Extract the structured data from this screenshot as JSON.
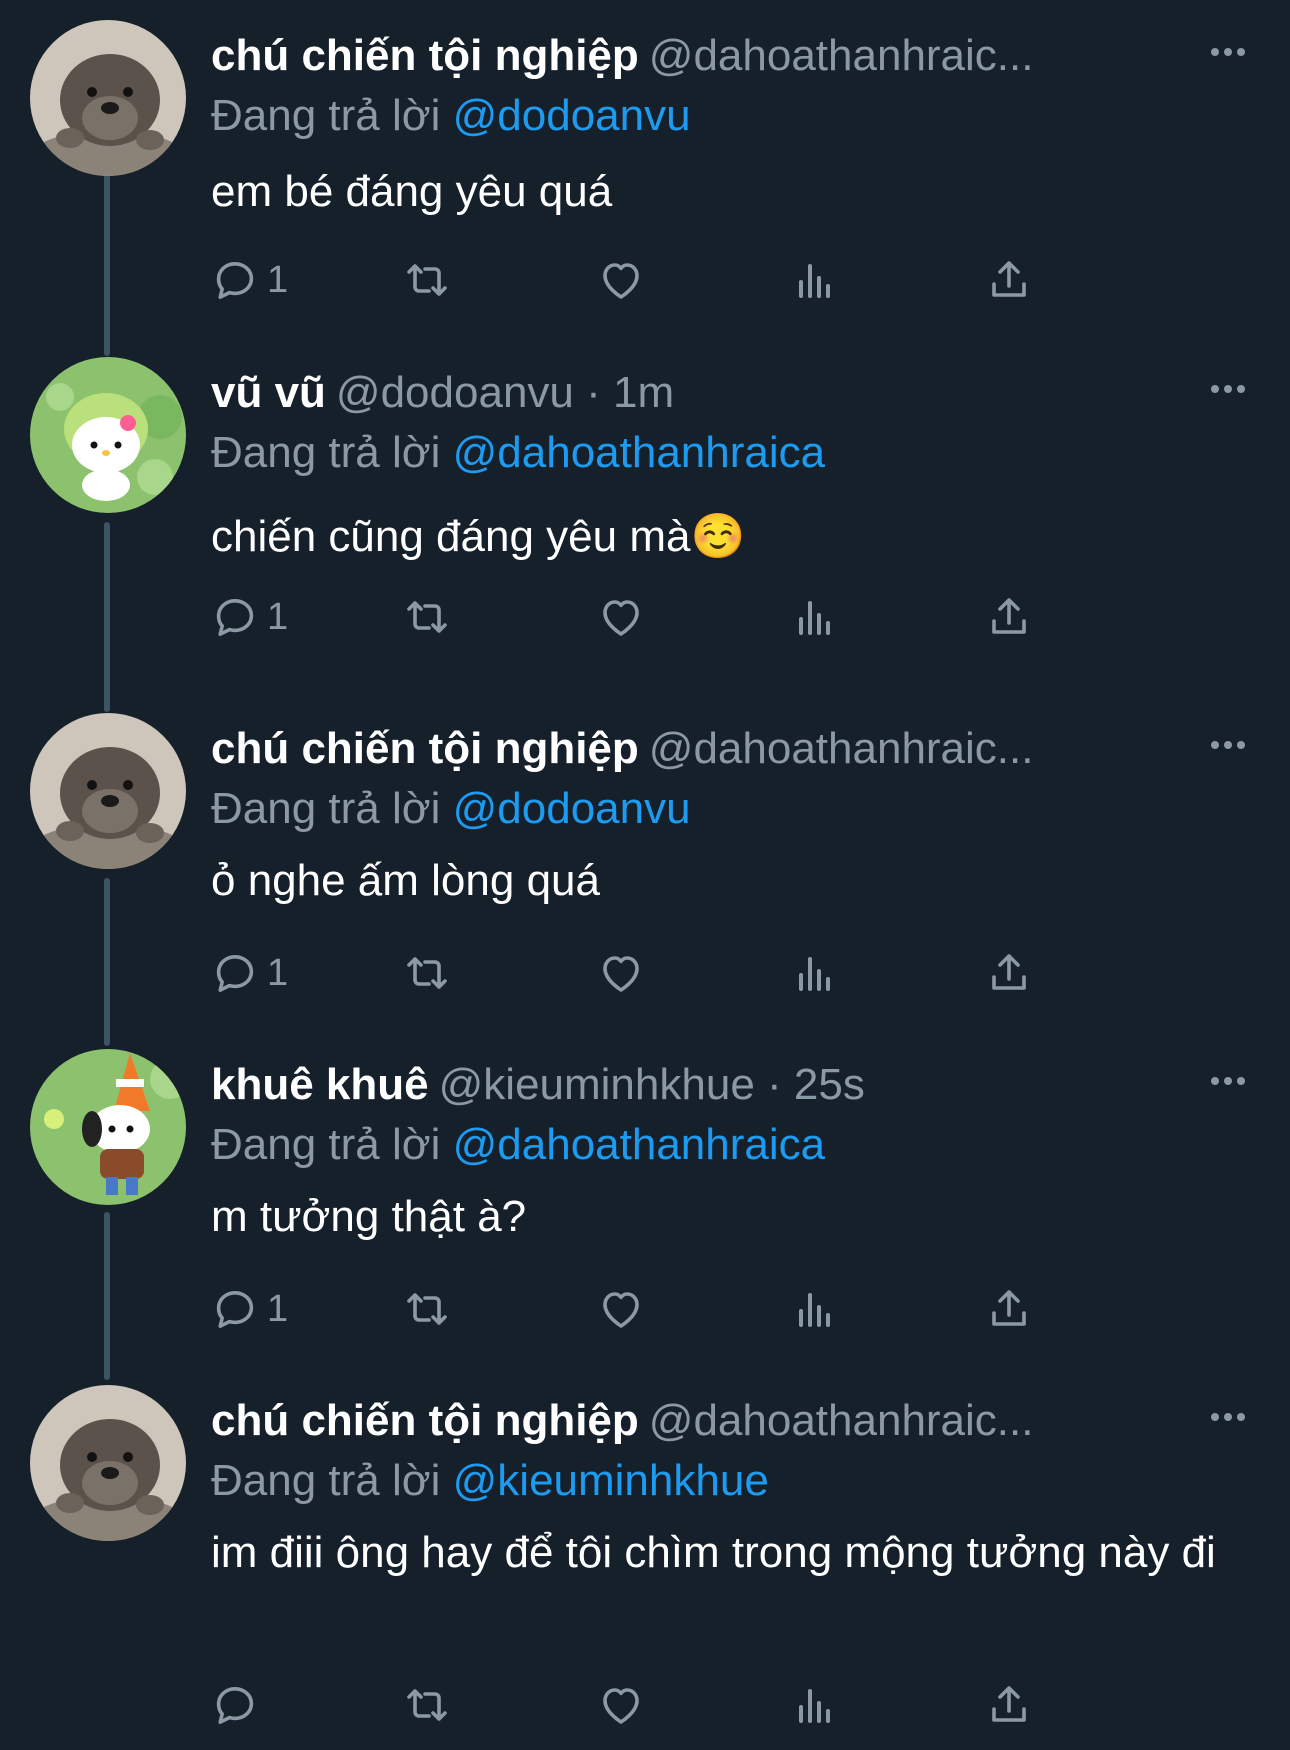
{
  "colors": {
    "background": "#15202b",
    "text_primary": "#ffffff",
    "text_secondary": "#8b98a5",
    "mention": "#1d9bf0",
    "thread_line": "#3d5466"
  },
  "tweets": [
    {
      "name": "chú chiến tội nghiệp",
      "handle": "@dahoathanhraic...",
      "time": "",
      "replying_prefix": "Đang trả lời",
      "replying_to": "@dodoanvu",
      "text": "em bé đáng yêu quá",
      "avatar": "otter-avatar",
      "reply_count": "1"
    },
    {
      "name": "vũ vũ",
      "handle": "@dodoanvu",
      "time": "· 1m",
      "replying_prefix": "Đang trả lời",
      "replying_to": "@dahoathanhraica",
      "text": "chiến cũng đáng yêu mà☺️",
      "avatar": "hello-kitty-avatar",
      "reply_count": "1"
    },
    {
      "name": "chú chiến tội nghiệp",
      "handle": "@dahoathanhraic...",
      "time": "",
      "replying_prefix": "Đang trả lời",
      "replying_to": "@dodoanvu",
      "text": "ỏ nghe ấm lòng quá",
      "avatar": "otter-avatar",
      "reply_count": "1"
    },
    {
      "name": "khuê khuê",
      "handle": "@kieuminhkhue",
      "time": "· 25s",
      "replying_prefix": "Đang trả lời",
      "replying_to": "@dahoathanhraica",
      "text": "m tưởng thật à?",
      "avatar": "pochacco-avatar",
      "reply_count": "1"
    },
    {
      "name": "chú chiến tội nghiệp",
      "handle": "@dahoathanhraic...",
      "time": "",
      "replying_prefix": "Đang trả lời",
      "replying_to": "@kieuminhkhue",
      "text": "im điii ông hay để tôi chìm trong mộng tưởng này đi",
      "avatar": "otter-avatar",
      "reply_count": ""
    }
  ]
}
